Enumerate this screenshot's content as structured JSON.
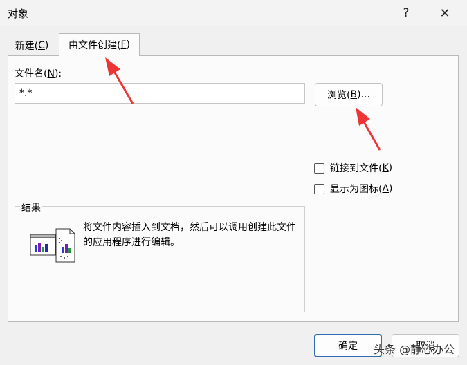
{
  "window": {
    "title": "对象",
    "help_glyph": "?",
    "close_glyph": "✕"
  },
  "tabs": [
    {
      "label": "新建(",
      "key": "C",
      "suffix": ")"
    },
    {
      "label": "由文件创建(",
      "key": "F",
      "suffix": ")"
    }
  ],
  "filename": {
    "label": "文件名(",
    "key": "N",
    "suffix": "):",
    "value": "*.*"
  },
  "browse": {
    "label": "浏览(",
    "key": "B",
    "suffix": ")..."
  },
  "options": [
    {
      "label": "链接到文件(",
      "key": "K",
      "suffix": ")",
      "checked": false
    },
    {
      "label": "显示为图标(",
      "key": "A",
      "suffix": ")",
      "checked": false
    }
  ],
  "result": {
    "title": "结果",
    "text": "将文件内容插入到文档，然后可以调用创建此文件的应用程序进行编辑。",
    "icon": "embedded-document-icon"
  },
  "buttons": {
    "ok": "确定",
    "cancel": "取消"
  },
  "watermark": "头条 @静心办公",
  "colors": {
    "annotation_arrow": "#ee3535",
    "default_button_border": "#2f6db5"
  }
}
